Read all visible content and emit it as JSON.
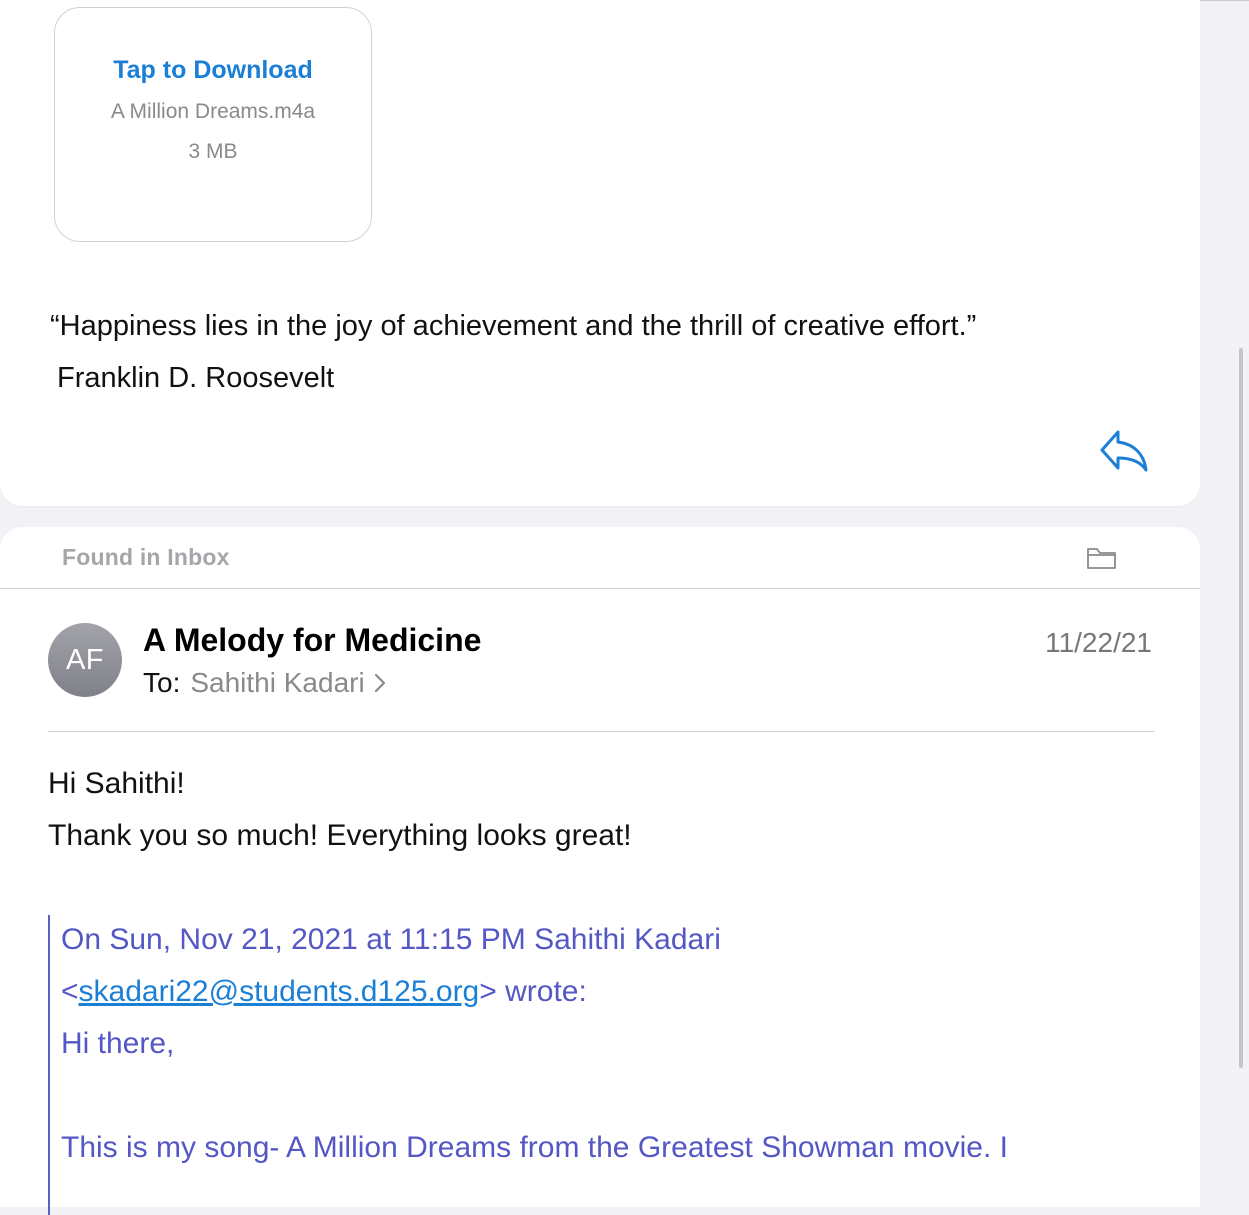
{
  "previous_message": {
    "attachment": {
      "action_label": "Tap to Download",
      "file_name": "A Million Dreams.m4a",
      "file_size": "3 MB"
    },
    "quote_text": "“Happiness lies in the joy of achievement and the thrill of creative effort.”",
    "quote_author": "Franklin D. Roosevelt",
    "reply_icon": "reply-arrow-icon"
  },
  "current_message": {
    "mailbox_label": "Found in Inbox",
    "folder_icon": "folder-icon",
    "avatar_initials": "AF",
    "sender": "A Melody for Medicine",
    "to_label": "To:",
    "recipient": "Sahithi Kadari",
    "date": "11/22/21",
    "body": {
      "greeting": "Hi Sahithi!",
      "line1": "Thank you so much! Everything looks great!"
    },
    "quoted": {
      "header_line1": "On Sun, Nov 21, 2021 at 11:15 PM Sahithi Kadari",
      "header_open": "<",
      "header_email": "skadari22@students.d125.org",
      "header_close": "> wrote:",
      "greeting": "Hi there,",
      "line1": "This is my song- A Million Dreams from the Greatest Showman movie. I"
    }
  },
  "colors": {
    "accent": "#1b7fd6",
    "quote_text": "#5457c4",
    "secondary_text": "#8a8a8e"
  }
}
